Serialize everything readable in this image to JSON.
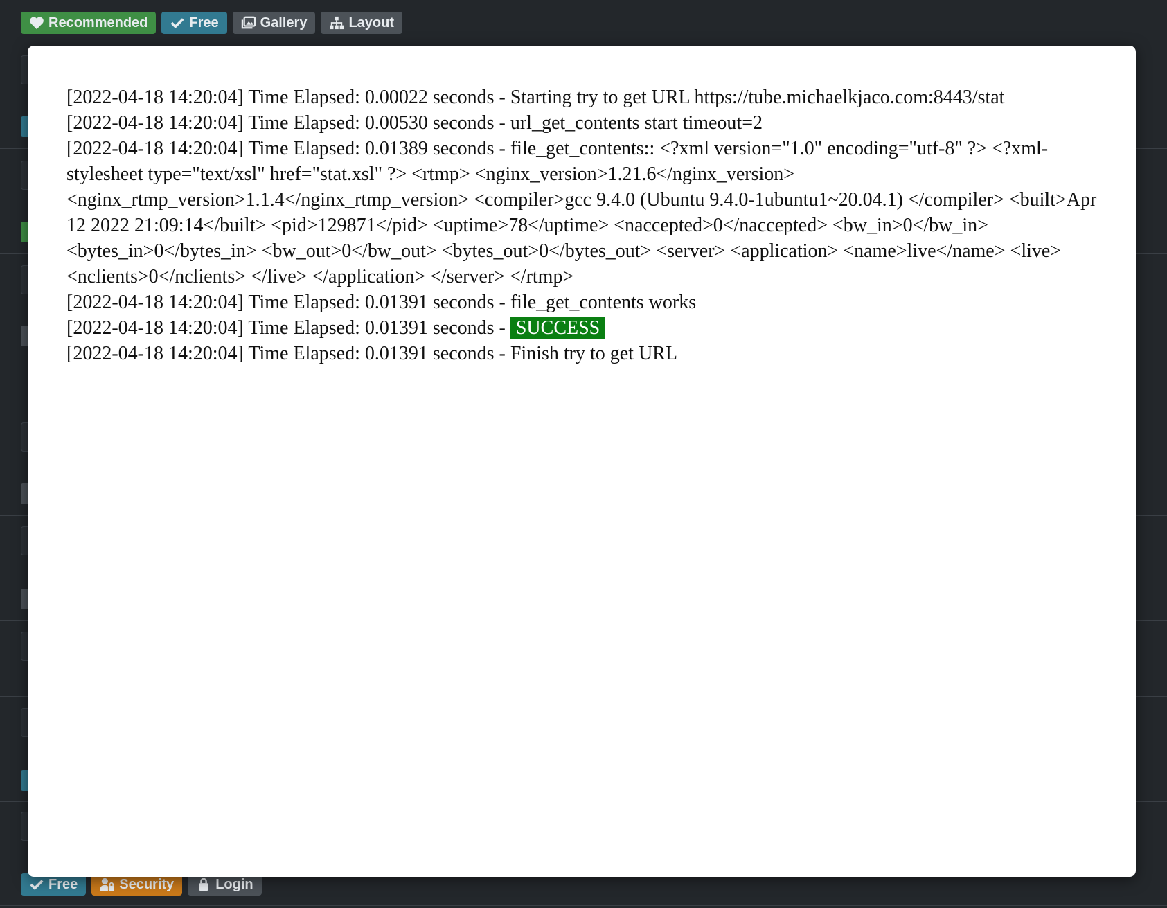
{
  "top_tags": [
    {
      "label": "Recommended",
      "icon": "heart-icon",
      "color": "#3f8f45"
    },
    {
      "label": "Free",
      "icon": "check-icon",
      "color": "#327a91"
    },
    {
      "label": "Gallery",
      "icon": "gallery-icon",
      "color": "#4c5258"
    },
    {
      "label": "Layout",
      "icon": "sitemap-icon",
      "color": "#4c5258"
    }
  ],
  "bottom_tags": [
    {
      "label": "Free",
      "icon": "check-icon",
      "color": "#327a91"
    },
    {
      "label": "Security",
      "icon": "user-lock-icon",
      "color": "#c9791a"
    },
    {
      "label": "Login",
      "icon": "lock-icon",
      "color": "#4c5258"
    }
  ],
  "log": {
    "lines": [
      "[2022-04-18 14:20:04] Time Elapsed: 0.00022 seconds - Starting try to get URL https://tube.michaelkjaco.com:8443/stat",
      "[2022-04-18 14:20:04] Time Elapsed: 0.00530 seconds - url_get_contents start timeout=2",
      "[2022-04-18 14:20:04] Time Elapsed: 0.01389 seconds - file_get_contents:: <?xml version=\"1.0\" encoding=\"utf-8\" ?> <?xml-stylesheet type=\"text/xsl\" href=\"stat.xsl\" ?> <rtmp> <nginx_version>1.21.6</nginx_version> <nginx_rtmp_version>1.1.4</nginx_rtmp_version> <compiler>gcc 9.4.0 (Ubuntu 9.4.0-1ubuntu1~20.04.1) </compiler> <built>Apr 12 2022 21:09:14</built> <pid>129871</pid> <uptime>78</uptime> <naccepted>0</naccepted> <bw_in>0</bw_in> <bytes_in>0</bytes_in> <bw_out>0</bw_out> <bytes_out>0</bytes_out> <server> <application> <name>live</name> <live> <nclients>0</nclients> </live> </application> </server> </rtmp>",
      "[2022-04-18 14:20:04] Time Elapsed: 0.01391 seconds - file_get_contents works"
    ],
    "success_prefix": "[2022-04-18 14:20:04] Time Elapsed: 0.01391 seconds - ",
    "success_label": "SUCCESS",
    "success_color": "#0a7f12",
    "finish_line": "[2022-04-18 14:20:04] Time Elapsed: 0.01391 seconds - Finish try to get URL"
  }
}
